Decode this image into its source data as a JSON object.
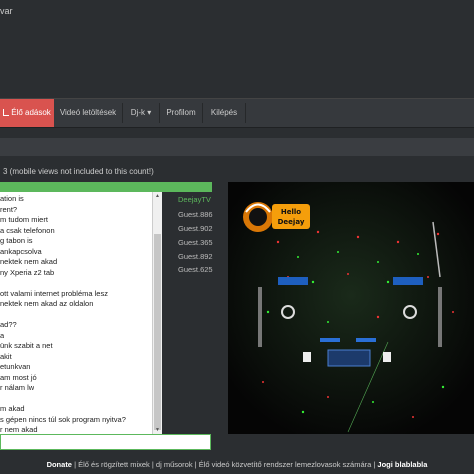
{
  "topbar": {
    "brand": "var"
  },
  "nav": {
    "items": [
      {
        "label": "Élő adások",
        "active": true
      },
      {
        "label": "Videó letöltések"
      },
      {
        "label": "Dj-k ▾"
      },
      {
        "label": "Profilom"
      },
      {
        "label": "Kilépés"
      }
    ]
  },
  "info": {
    "text": "3 (mobile views not included to this count!)"
  },
  "chat": {
    "lines": [
      "ation is",
      "rent?",
      "m tudom miert",
      "a csak telefonon",
      "g tabon is",
      "ankapcsolva",
      "nektek nem akad",
      "ny Xperia z2 tab",
      "",
      "ott valami internet probléma lesz",
      "  nektek nem akad az oldalon",
      "",
      "ad??",
      "a",
      "ünk szabit a net",
      "akit",
      "etunkvan",
      "am most jó",
      "r nálam lw",
      "",
      "m akad",
      "s gépen nincs túl sok program nyitva?",
      "r nem akad"
    ]
  },
  "users": [
    {
      "name": "DeejayTV",
      "dj": true
    },
    {
      "name": "Guest.886"
    },
    {
      "name": "Guest.902"
    },
    {
      "name": "Guest.365"
    },
    {
      "name": "Guest.892"
    },
    {
      "name": "Guest.625"
    }
  ],
  "video": {
    "logo_text_1": "Hello",
    "logo_text_2": "Deejay"
  },
  "footer": {
    "donate": "Donate",
    "rest": " | Élő és rögzített mixek | dj műsorok | Élő videó közvetítő rendszer lemezlovasok számára | ",
    "jogi": "Jogi blablabla"
  },
  "colors": {
    "accent": "#d9534f",
    "green": "#5cb85c",
    "background": "#2b2e31"
  }
}
